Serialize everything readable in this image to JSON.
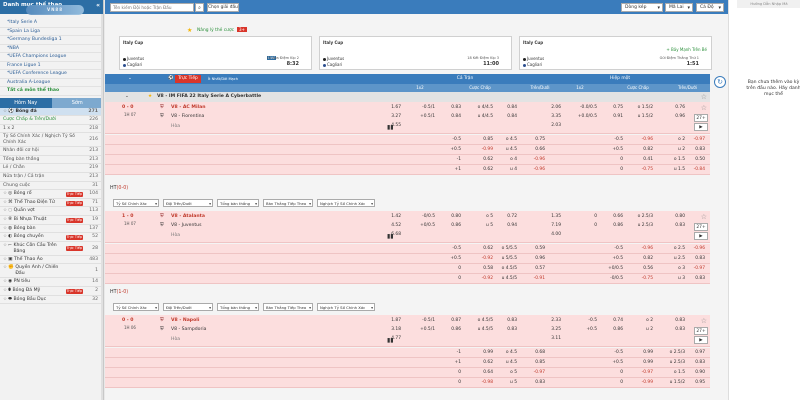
{
  "sidebar": {
    "title": "Danh mục thể thao",
    "logo": "VN88",
    "leagues": [
      "*Italy Serie A",
      "*Spain La Liga",
      "*Germany Bundesliga 1",
      "*NBA",
      "*UEFA Champions League",
      "France Ligue 1",
      "*UEFA Conference League",
      "Australia A-League"
    ],
    "all_sports": "Tất cả môn thể thao",
    "tabs": [
      "Hôm Nay",
      "Sớm"
    ],
    "football": {
      "label": "Bóng đá",
      "count": "271"
    },
    "sub": [
      {
        "label": "Cược Chấp & Trên/Dưới",
        "count": "226",
        "green": true
      },
      {
        "label": "1 x 2",
        "count": "218"
      },
      {
        "label": "Tỷ Số Chính Xác / Nghịch Tỷ Số Chính Xác",
        "count": "216"
      },
      {
        "label": "Nhân đôi cơ hội",
        "count": "213"
      },
      {
        "label": "Tổng bàn thắng",
        "count": "213"
      },
      {
        "label": "Lẻ / Chẵn",
        "count": "219"
      },
      {
        "label": "Nửa trận / Cả trận",
        "count": "213"
      },
      {
        "label": "Chung cuộc",
        "count": "31"
      }
    ],
    "sports": [
      {
        "label": "Bóng rổ",
        "count": "104",
        "badge": "Trực Tiếp"
      },
      {
        "label": "Thể Thao Điện Tử",
        "count": "71",
        "badge": "Trực Tiếp"
      },
      {
        "label": "Quần vợt",
        "count": "113"
      },
      {
        "label": "Bi Nhựa Thuật",
        "count": "19",
        "badge": "Trực Tiếp"
      },
      {
        "label": "Bóng bàn",
        "count": "137"
      },
      {
        "label": "Bóng chuyền",
        "count": "52",
        "badge": "Trực Tiếp"
      },
      {
        "label": "Khúc Côn Cầu Trên Băng",
        "count": "28",
        "badge": "Trực Tiếp"
      },
      {
        "label": "Thể Thao Ảo",
        "count": "483"
      },
      {
        "label": "Quyền Anh / Chiến Đấu",
        "count": "1"
      },
      {
        "label": "PN tiêu",
        "count": "14"
      },
      {
        "label": "Bóng Đá Mỹ",
        "count": "2",
        "badge": "Trực Tiếp"
      },
      {
        "label": "Bóng Bầu Dục",
        "count": "32"
      }
    ]
  },
  "topbar": {
    "search_placeholder": "Tên kiếm Đội hoặc Trận Đấu",
    "pick_label": "Chọn giải đấu",
    "sort_label": "Dòng kép",
    "odds_label": "Mã Lai",
    "type_label": "Cá Độ"
  },
  "fav": {
    "label": "Nâng lý thẻ cược",
    "count": "3+"
  },
  "cards": [
    {
      "league": "Italy Cup",
      "home": "Juventus",
      "away": "Cagliari",
      "date": "12 Aza Điệm Kip 2",
      "time": "8:32",
      "corner": "0 · 0"
    },
    {
      "league": "Italy Cup",
      "home": "Juventus",
      "away": "Cagliari",
      "date": "18 Kết Điệm Kip 3",
      "time": "11:00",
      "corner": "0 · 0"
    },
    {
      "league": "Italy Cup",
      "home": "Juventus",
      "away": "Cagliari",
      "date": "Gửi Điệm Thắng Thứ 1",
      "time": "1:51",
      "corner": "0 · 0",
      "fav": "+ Bảy Mạnh Trên Bé"
    }
  ],
  "header": {
    "live": "Trực Tiếp",
    "live_sub": "Ít Nhất/Dời Mạch",
    "full": "Cả Trận",
    "half": "Hiệp một",
    "cols": [
      "1x2",
      "Cược Chấp",
      "Trên/Dưới",
      "1x2",
      "Cược Chấp",
      "Trên/Dưới"
    ]
  },
  "league_title": "V8 - IM FIFA 22 Italy Serie A Cyberbattle",
  "matches": [
    {
      "score": "0 - 0",
      "time": "1H 07",
      "home": "V8 - AC Milan",
      "away": "V8 - Fiorentina",
      "draw": "Hòa",
      "rows": [
        [
          "1.67",
          "-0.5/1",
          "0.83",
          "o 4/4.5",
          "0.84",
          "2.06",
          "-0.0/0.5",
          "0.75",
          "o 1.5/2",
          "0.76"
        ],
        [
          "3.27",
          "+0.5/1",
          "0.84",
          "u 4/4.5",
          "0.84",
          "3.35",
          "+0.0/0.5",
          "0.91",
          "u 1.5/2",
          "0.96"
        ],
        [
          "4.55",
          "",
          "",
          "",
          "",
          "2.03",
          "",
          "",
          "",
          ""
        ]
      ],
      "extra": [
        [
          "-0.5",
          "0.85",
          "o 4.5",
          "0.75",
          "-0.5",
          "-0.96",
          "o 2",
          "-0.97"
        ],
        [
          "+0.5",
          "-0.99",
          "u 4.5",
          "0.66",
          "+0.5",
          "0.82",
          "u 2",
          "0.83"
        ],
        [
          "-1",
          "0.62",
          "o 4",
          "-0.96",
          "0",
          "0.41",
          "o 1.5",
          "0.50"
        ],
        [
          "+1",
          "0.62",
          "u 4",
          "-0.96",
          "0",
          "-0.75",
          "u 1.5",
          "-0.84"
        ]
      ]
    },
    {
      "ht": "HT",
      "ht_score": "(0-0)",
      "score": "1 - 0",
      "time": "1H 07",
      "home": "V8 - Atalanta",
      "away": "V8 - Juventus",
      "draw": "Hòa",
      "rows": [
        [
          "1.42",
          "-0/0.5",
          "0.80",
          "o 5",
          "0.72",
          "1.35",
          "0",
          "0.66",
          "o 2.5/3",
          "0.80"
        ],
        [
          "4.52",
          "+0/0.5",
          "0.86",
          "u 5",
          "0.94",
          "7.19",
          "0",
          "0.86",
          "u 2.5/3",
          "0.83"
        ],
        [
          "6.68",
          "",
          "",
          "",
          "",
          "4.00",
          "",
          "",
          "",
          ""
        ]
      ],
      "extra": [
        [
          "-0.5",
          "0.62",
          "o 5/5.5",
          "0.59",
          "-0.5",
          "-0.96",
          "o 2.5",
          "-0.96"
        ],
        [
          "+0.5",
          "-0.92",
          "u 5/5.5",
          "0.96",
          "+0.5",
          "0.82",
          "u 2.5",
          "0.83"
        ],
        [
          "0",
          "0.58",
          "o 4.5/5",
          "0.57",
          "+0/0.5",
          "0.56",
          "o 3",
          "-0.97"
        ],
        [
          "0",
          "-0.92",
          "u 4.5/5",
          "-0.91",
          "-0/0.5",
          "-0.75",
          "u 3",
          "0.83"
        ]
      ]
    },
    {
      "ht": "HT",
      "ht_score": "(1-0)",
      "score": "0 - 0",
      "time": "1H 06",
      "home": "V8 - Napoli",
      "away": "V8 - Sampdoria",
      "draw": "Hòa",
      "rows": [
        [
          "1.87",
          "-0.5/1",
          "0.87",
          "o 4.5/5",
          "0.83",
          "2.33",
          "-0.5",
          "0.74",
          "o 2",
          "0.83"
        ],
        [
          "3.18",
          "+0.5/1",
          "0.86",
          "u 4.5/5",
          "0.83",
          "3.25",
          "+0.5",
          "0.86",
          "u 2",
          "0.83"
        ],
        [
          "4.77",
          "",
          "",
          "",
          "",
          "3.11",
          "",
          "",
          "",
          ""
        ]
      ],
      "extra": [
        [
          "-1",
          "0.99",
          "o 4.5",
          "0.68",
          "-0.5",
          "0.99",
          "o 2.5/3",
          "0.97"
        ],
        [
          "+1",
          "0.62",
          "u 4.5",
          "0.85",
          "+0.5",
          "0.99",
          "u 2.5/3",
          "0.83"
        ],
        [
          "0",
          "0.64",
          "o 5",
          "-0.97",
          "0",
          "-0.97",
          "o 1.5",
          "0.90"
        ],
        [
          "0",
          "-0.98",
          "u 5",
          "0.83",
          "0",
          "-0.99",
          "u 1.5/2",
          "0.95"
        ]
      ]
    }
  ],
  "filters": [
    "Tỷ Số Chính Xác",
    "Đội Trên/Dưới",
    "Tổng bàn thắng",
    "Bàn Thắng Tiếp Theo",
    "Nghịch Tỷ Số Chính Xác"
  ],
  "more": "27+",
  "right_panel": {
    "top": "Hướng Dẫn Nhập Mã",
    "msg": "Bạn chưa thêm vào kỳ trên đầu nào. Hãy danh mục thể"
  }
}
